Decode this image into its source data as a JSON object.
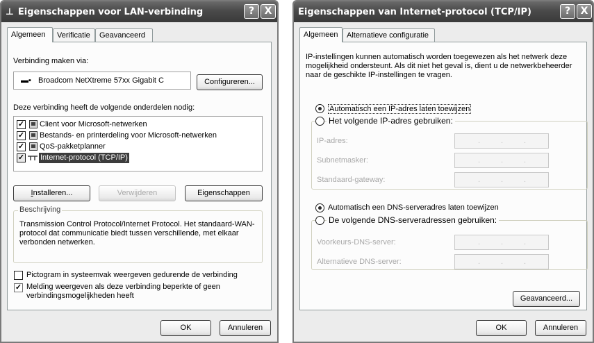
{
  "lan_dialog": {
    "title": "Eigenschappen voor LAN-verbinding",
    "help_glyph": "?",
    "close_glyph": "X",
    "tabs": [
      "Algemeen",
      "Verificatie",
      "Geavanceerd"
    ],
    "connect_via_label": "Verbinding maken via:",
    "adapter_name": "Broadcom NetXtreme 57xx Gigabit C",
    "configure_button": "Configureren...",
    "components_label": "Deze verbinding heeft de volgende onderdelen nodig:",
    "components": [
      {
        "label": "Client voor Microsoft-netwerken",
        "checked": true,
        "icon": "network-client-icon"
      },
      {
        "label": "Bestands- en printerdeling voor Microsoft-netwerken",
        "checked": true,
        "icon": "file-printer-sharing-icon"
      },
      {
        "label": "QoS-pakketplanner",
        "checked": true,
        "icon": "qos-scheduler-icon"
      },
      {
        "label": "Internet-protocol (TCP/IP)",
        "checked": true,
        "icon": "protocol-icon",
        "selected": true
      }
    ],
    "install_button": "Installeren...",
    "remove_button": "Verwijderen",
    "properties_button": "Eigenschappen",
    "description_legend": "Beschrijving",
    "description_text": "Transmission Control Protocol/Internet Protocol. Het standaard-WAN-protocol dat communicatie biedt tussen verschillende, met elkaar verbonden netwerken.",
    "show_icon_label": "Pictogram in systeemvak weergeven gedurende de verbinding",
    "show_icon_checked": false,
    "notify_label": "Melding weergeven als deze verbinding beperkte of geen verbindingsmogelijkheden heeft",
    "notify_checked": true,
    "ok_button": "OK",
    "cancel_button": "Annuleren"
  },
  "tcp_dialog": {
    "title": "Eigenschappen van Internet-protocol (TCP/IP)",
    "help_glyph": "?",
    "close_glyph": "X",
    "tabs": [
      "Algemeen",
      "Alternatieve configuratie"
    ],
    "intro_text": "IP-instellingen kunnen automatisch worden toegewezen als het netwerk deze mogelijkheid ondersteunt. Als dit niet het geval is, dient u de netwerkbeheerder naar de geschikte IP-instellingen te vragen.",
    "auto_ip_label": "Automatisch een IP-adres laten toewijzen",
    "manual_ip_label": "Het volgende IP-adres gebruiken:",
    "ip_address_label": "IP-adres:",
    "subnet_label": "Subnetmasker:",
    "gateway_label": "Standaard-gateway:",
    "auto_dns_label": "Automatisch een DNS-serveradres laten toewijzen",
    "manual_dns_label": "De volgende DNS-serveradressen gebruiken:",
    "preferred_dns_label": "Voorkeurs-DNS-server:",
    "alternate_dns_label": "Alternatieve DNS-server:",
    "ip_dot": ".",
    "advanced_button": "Geavanceerd...",
    "ok_button": "OK",
    "cancel_button": "Annuleren",
    "auto_ip_selected": true,
    "auto_dns_selected": true
  }
}
